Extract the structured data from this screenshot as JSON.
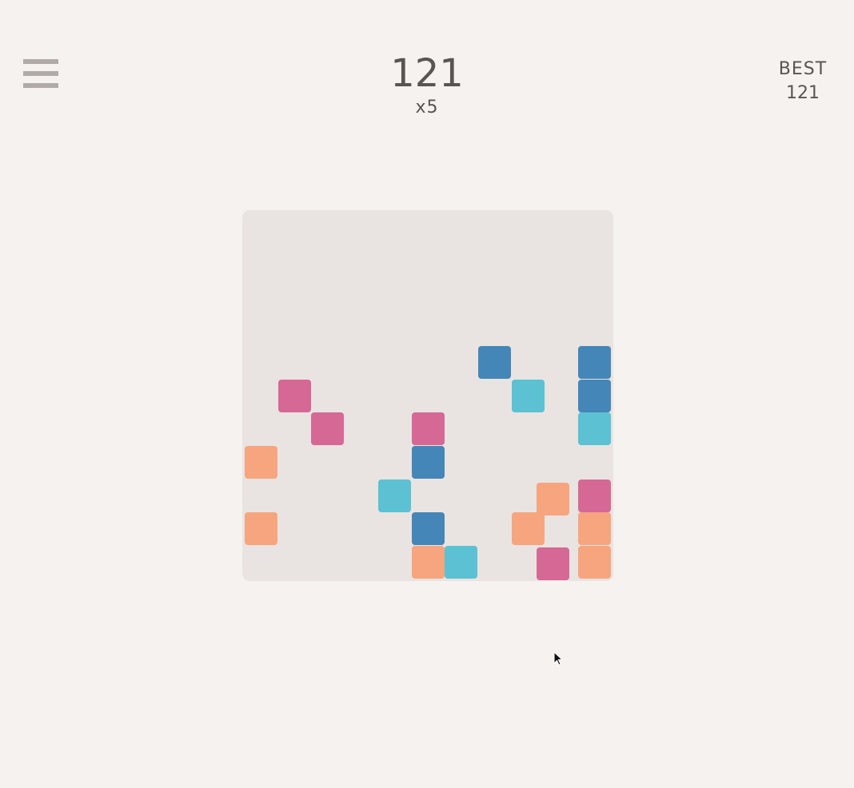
{
  "header": {
    "menu_icon": "hamburger-menu-icon",
    "score": "121",
    "multiplier": "x5",
    "best_label": "BEST",
    "best_value": "121"
  },
  "colors": {
    "background": "#f5f2ef",
    "board": "#e9e4e1",
    "text": "#5a5452",
    "menu_icon": "#b2aaa9",
    "pink": "#d66895",
    "blue": "#4586b8",
    "cyan": "#5bc1d3",
    "orange": "#f7a57e"
  },
  "board": {
    "columns": 11,
    "rows": 11,
    "tiles": [
      {
        "col": 7,
        "row": 4,
        "color": "blue"
      },
      {
        "col": 10,
        "row": 4,
        "color": "blue"
      },
      {
        "col": 1,
        "row": 5,
        "color": "pink"
      },
      {
        "col": 8,
        "row": 5,
        "color": "cyan"
      },
      {
        "col": 10,
        "row": 5,
        "color": "blue"
      },
      {
        "col": 2,
        "row": 6,
        "color": "pink"
      },
      {
        "col": 5,
        "row": 6,
        "color": "pink"
      },
      {
        "col": 10,
        "row": 6,
        "color": "cyan"
      },
      {
        "col": 0,
        "row": 7,
        "color": "orange"
      },
      {
        "col": 5,
        "row": 7,
        "color": "blue"
      },
      {
        "col": 4,
        "row": 8,
        "color": "cyan"
      },
      {
        "col": 8.75,
        "row": 8.1,
        "color": "orange"
      },
      {
        "col": 10,
        "row": 8,
        "color": "pink"
      },
      {
        "col": 0,
        "row": 9,
        "color": "orange"
      },
      {
        "col": 5,
        "row": 9,
        "color": "blue"
      },
      {
        "col": 8,
        "row": 9,
        "color": "orange"
      },
      {
        "col": 10,
        "row": 9,
        "color": "orange"
      },
      {
        "col": 5,
        "row": 10,
        "color": "orange"
      },
      {
        "col": 6,
        "row": 10,
        "color": "cyan"
      },
      {
        "col": 8.75,
        "row": 10.05,
        "color": "pink"
      },
      {
        "col": 10,
        "row": 10,
        "color": "orange"
      }
    ]
  }
}
